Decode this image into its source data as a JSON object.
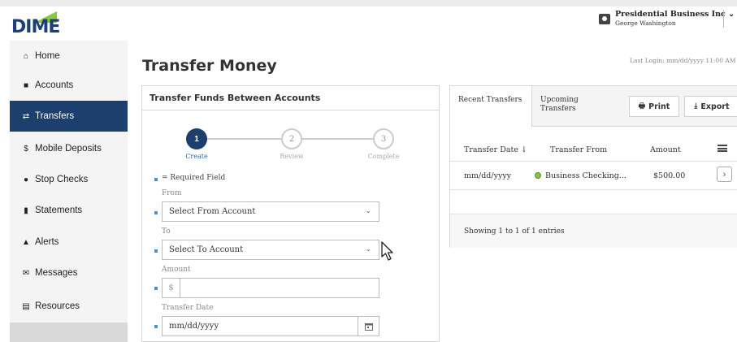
{
  "brand": {
    "logo_text": "DIME",
    "accent_color": "#1d3f6e",
    "logo_mark_color": "#8dc63f"
  },
  "user": {
    "company": "Presidential Business Inc ⌄",
    "name": "George Washington"
  },
  "last_login": "Last Login: mm/dd/yyyy 11:00 AM",
  "sidebar": {
    "items": [
      {
        "label": "Home",
        "icon": "home-icon",
        "glyph": "⌂"
      },
      {
        "label": "Accounts",
        "icon": "accounts-icon",
        "glyph": "■"
      },
      {
        "label": "Transfers",
        "icon": "transfers-icon",
        "glyph": "⇄"
      },
      {
        "label": "Mobile Deposits",
        "icon": "dollar-icon",
        "glyph": "$"
      },
      {
        "label": "Stop Checks",
        "icon": "stop-icon",
        "glyph": "●"
      },
      {
        "label": "Statements",
        "icon": "statements-icon",
        "glyph": "▮"
      },
      {
        "label": "Alerts",
        "icon": "bell-icon",
        "glyph": "▲"
      },
      {
        "label": "Messages",
        "icon": "envelope-icon",
        "glyph": "✉"
      },
      {
        "label": "Resources",
        "icon": "resources-icon",
        "glyph": "▤"
      }
    ],
    "active_index": 2
  },
  "page": {
    "title": "Transfer Money"
  },
  "transfer_form": {
    "header": "Transfer Funds Between Accounts",
    "steps": [
      {
        "number": "1",
        "label": "Create"
      },
      {
        "number": "2",
        "label": "Review"
      },
      {
        "number": "3",
        "label": "Complete"
      }
    ],
    "current_step": 1,
    "required_note": "= Required Field",
    "from_label": "From",
    "from_value": "Select From Account",
    "to_label": "To",
    "to_value": "Select To Account",
    "amount_label": "Amount",
    "amount_prefix": "$",
    "amount_value": "",
    "date_label": "Transfer Date",
    "date_value": "mm/dd/yyyy"
  },
  "transfers_panel": {
    "tabs": [
      {
        "label": "Recent Transfers"
      },
      {
        "label": "Upcoming Transfers"
      }
    ],
    "print_label": "Print",
    "export_label": "Export",
    "columns": [
      "Transfer Date ↓",
      "Transfer From",
      "Amount"
    ],
    "rows": [
      {
        "date": "mm/dd/yyyy",
        "from": "Business Checking...",
        "amount": "$500.00"
      }
    ],
    "footer": "Showing 1 to 1 of 1 entries"
  }
}
